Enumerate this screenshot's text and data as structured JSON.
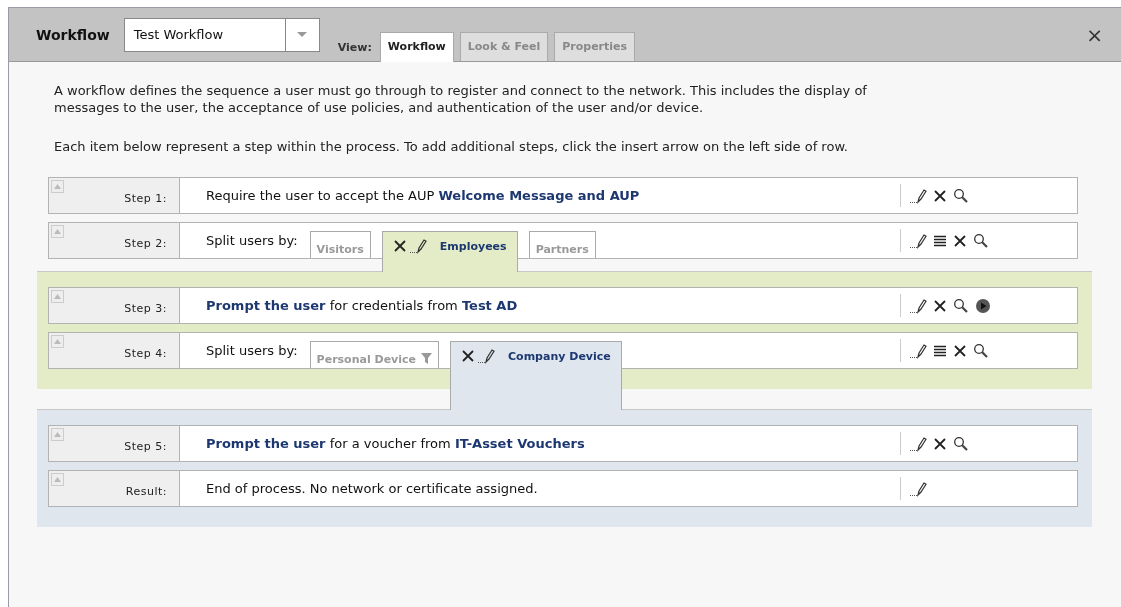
{
  "header": {
    "title": "Workflow",
    "workflow": {
      "value": "Test Workflow"
    },
    "view_label": "View:",
    "tabs": [
      {
        "label": "Workflow",
        "selected": true
      },
      {
        "label": "Look & Feel",
        "selected": false
      },
      {
        "label": "Properties",
        "selected": false
      }
    ],
    "close": "×"
  },
  "intro": [
    "A workflow defines the sequence a user must go through to register and connect to the network. This includes the display of messages to the user, the acceptance of use policies, and authentication of the user and/or device.",
    "Each item below represent a step within the process. To add additional steps, click the insert arrow on the left side of row."
  ],
  "steps": [
    {
      "label": "Step 1:",
      "kind": "text",
      "text": "Require the user to accept the AUP **Welcome Message and AUP**",
      "actions": [
        {
          "kind": "edit"
        },
        {
          "kind": "delete"
        },
        {
          "kind": "search"
        }
      ]
    },
    {
      "label": "Step 2:",
      "kind": "split",
      "text": "Split users by:",
      "actions": [
        {
          "kind": "edit"
        },
        {
          "kind": "list"
        },
        {
          "kind": "delete"
        },
        {
          "kind": "search"
        }
      ],
      "branches": [
        {
          "label": "Visitors",
          "selected": false
        },
        {
          "label": "Employees",
          "selected": true,
          "color": "#e3ecc6",
          "children": [
            {
              "label": "Step 3:",
              "kind": "text",
              "text": "**Prompt the user** for credentials from **Test AD**",
              "actions": [
                {
                  "kind": "edit"
                },
                {
                  "kind": "delete"
                },
                {
                  "kind": "search"
                },
                {
                  "kind": "play"
                }
              ]
            },
            {
              "label": "Step 4:",
              "kind": "split",
              "text": "Split users by:",
              "actions": [
                {
                  "kind": "edit"
                },
                {
                  "kind": "list"
                },
                {
                  "kind": "delete"
                },
                {
                  "kind": "search"
                }
              ],
              "branches": [
                {
                  "label": "Personal Device",
                  "selected": false,
                  "filtered": true
                },
                {
                  "label": "Company Device",
                  "selected": true,
                  "color": "#dfe6ee",
                  "children": [
                    {
                      "label": "Step 5:",
                      "kind": "text",
                      "text": "**Prompt the user** for a voucher from **IT-Asset Vouchers**",
                      "actions": [
                        {
                          "kind": "edit"
                        },
                        {
                          "kind": "delete"
                        },
                        {
                          "kind": "search"
                        }
                      ]
                    },
                    {
                      "label": "Result:",
                      "kind": "text",
                      "text": "End of process. No network or certificate assigned.",
                      "actions": [
                        {
                          "kind": "edit"
                        }
                      ]
                    }
                  ]
                }
              ]
            }
          ]
        },
        {
          "label": "Partners",
          "selected": false
        }
      ]
    }
  ]
}
